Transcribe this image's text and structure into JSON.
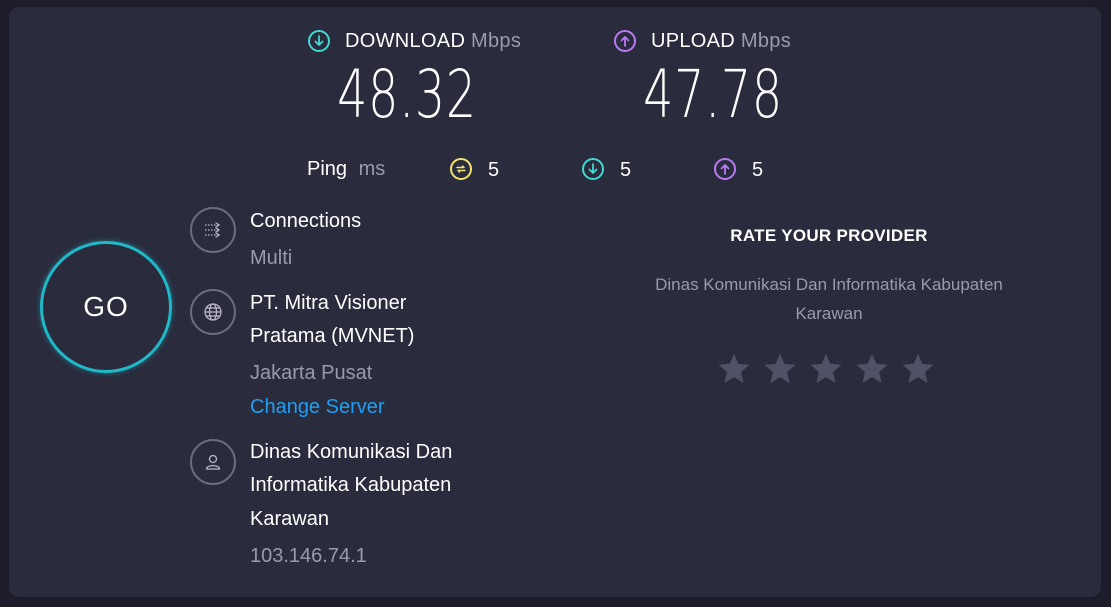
{
  "download": {
    "label": "DOWNLOAD",
    "unit": "Mbps",
    "value": "48.32",
    "color": "#3fd9d0"
  },
  "upload": {
    "label": "UPLOAD",
    "unit": "Mbps",
    "value": "47.78",
    "color": "#b77cf1"
  },
  "ping": {
    "label": "Ping",
    "unit": "ms",
    "idle": {
      "value": "5",
      "icon": "ping-idle-icon",
      "color": "#f2e36b"
    },
    "download": {
      "value": "5",
      "icon": "download-arrow-icon",
      "color": "#3fd9d0"
    },
    "upload": {
      "value": "5",
      "icon": "upload-arrow-icon",
      "color": "#b77cf1"
    }
  },
  "go_button": {
    "label": "GO",
    "color": "#1fb9c8"
  },
  "connections": {
    "title": "Connections",
    "value": "Multi",
    "icon": "connections-icon"
  },
  "server": {
    "line1": "PT. Mitra Visioner",
    "line2": "Pratama (MVNET)",
    "location": "Jakarta Pusat",
    "change_label": "Change Server",
    "icon": "globe-icon"
  },
  "provider": {
    "line1": "Dinas Komunikasi Dan",
    "line2": "Informatika Kabupaten",
    "line3": "Karawan",
    "ip": "103.146.74.1",
    "icon": "user-icon"
  },
  "rating": {
    "title": "RATE YOUR PROVIDER",
    "isp_line1": "Dinas Komunikasi Dan Informatika Kabupaten",
    "isp_line2": "Karawan",
    "stars_total": 5,
    "stars_selected": 0,
    "star_color": "#505166"
  }
}
